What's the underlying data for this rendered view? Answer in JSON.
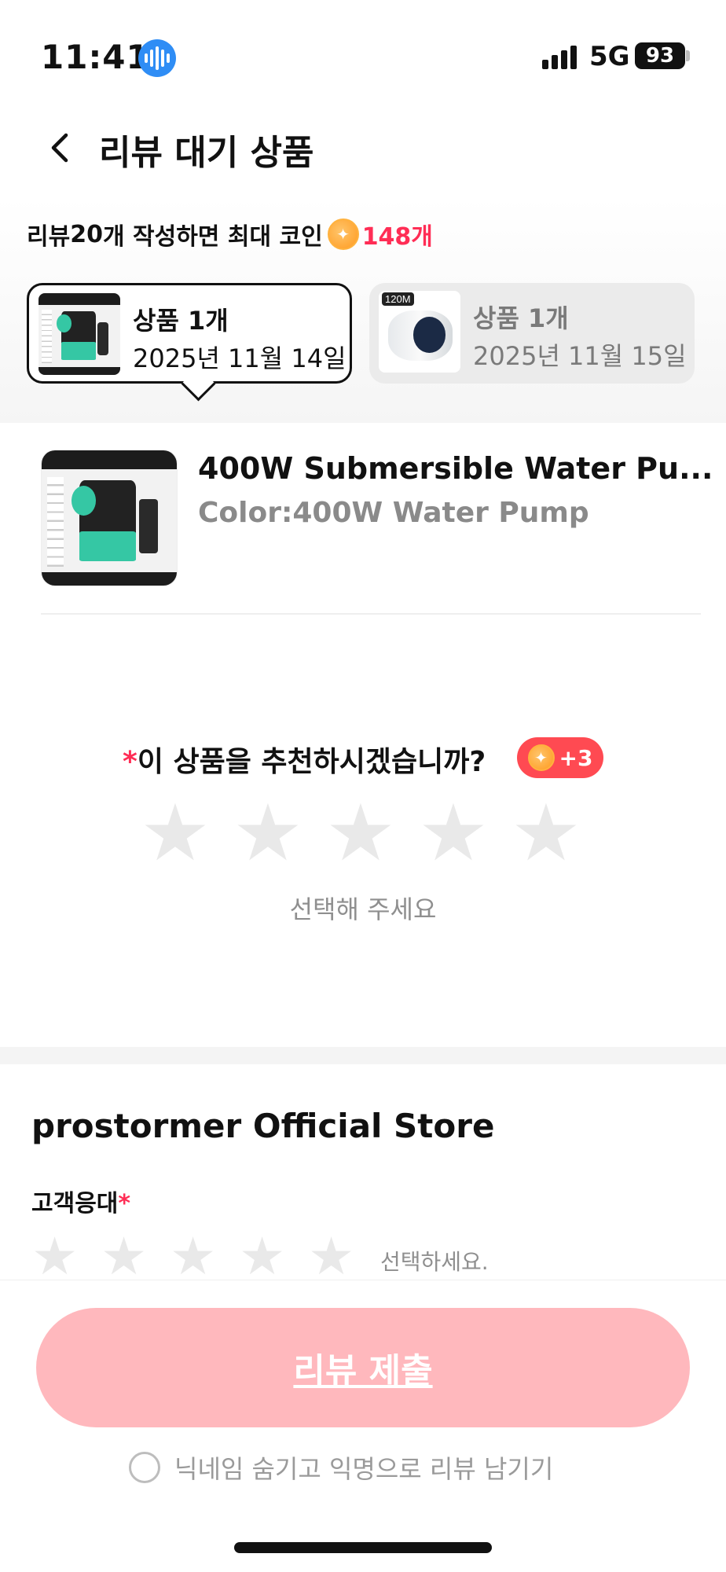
{
  "status_bar": {
    "time": "11:41",
    "network": "5G",
    "battery": "93"
  },
  "header": {
    "title": "리뷰 대기 상품"
  },
  "promo": {
    "prefix": "리뷰 ",
    "count": "20",
    "middle": "개 작성하면 최대 코인",
    "coins": "148개"
  },
  "tabs": [
    {
      "count_label": "상품 1개",
      "date": "2025년 11월 14일",
      "selected": true
    },
    {
      "badge": "120M",
      "count_label": "상품 1개",
      "date": "2025년 11월 15일",
      "selected": false
    }
  ],
  "product": {
    "name": "400W Submersible Water Pu...",
    "option": "Color:400W Water Pump"
  },
  "recommend": {
    "required_mark": "*",
    "question": "이 상품을 추천하시겠습니까?",
    "bonus": "+3",
    "hint": "선택해 주세요",
    "rating": 0,
    "max_rating": 5
  },
  "store": {
    "name": "prostormer Official Store",
    "criteria_label": "고객응대",
    "required_mark": "*",
    "hint": "선택하세요.",
    "rating": 0
  },
  "footer": {
    "submit_label": "리뷰 제출",
    "anonymous_label": "닉네임 숨기고 익명으로 리뷰 남기기",
    "anonymous_checked": false
  },
  "colors": {
    "accent": "#ff2d55",
    "submit_disabled": "#ffb8bd",
    "star_empty": "#e9e9e9"
  }
}
